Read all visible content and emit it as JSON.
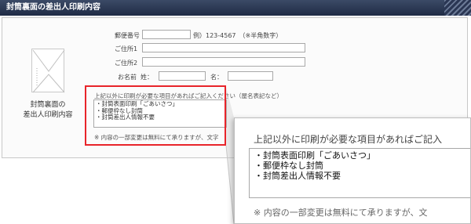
{
  "header": {
    "title": "封筒裏面の差出人印刷内容"
  },
  "illustration": {
    "caption_line1": "封筒裏面の",
    "caption_line2": "差出人印刷内容",
    "icon": "envelope-icon"
  },
  "form": {
    "postal_label": "郵便番号",
    "postal_value": "",
    "postal_example": "例）123-4567　（※半角数字）",
    "address1_label": "ご住所1",
    "address1_value": "",
    "address2_label": "ご住所2",
    "address2_value": "",
    "name_label": "お名前",
    "sei_label": "姓：",
    "sei_value": "",
    "mei_label": "名：",
    "mei_value": ""
  },
  "remarks": {
    "label": "上記以外に印刷が必要な項目があればご記入ください（屋名表記など）",
    "lines": [
      "・封筒表面印刷「ごあいさつ」",
      "・郵便枠なし封筒",
      "・封筒差出人情報不要"
    ],
    "note": "※ 内容の一部変更は無料にて承りますが、文字"
  },
  "zoom": {
    "label": "上記以外に印刷が必要な項目があればご記入",
    "lines": [
      "・封筒表面印刷「ごあいさつ」",
      "・郵便枠なし封筒",
      "・封筒差出人情報不要"
    ],
    "note": "※ 内容の一部変更は無料にて承りますが、文"
  },
  "colors": {
    "header_bg": "#1f2b45",
    "highlight": "#e8242a"
  }
}
